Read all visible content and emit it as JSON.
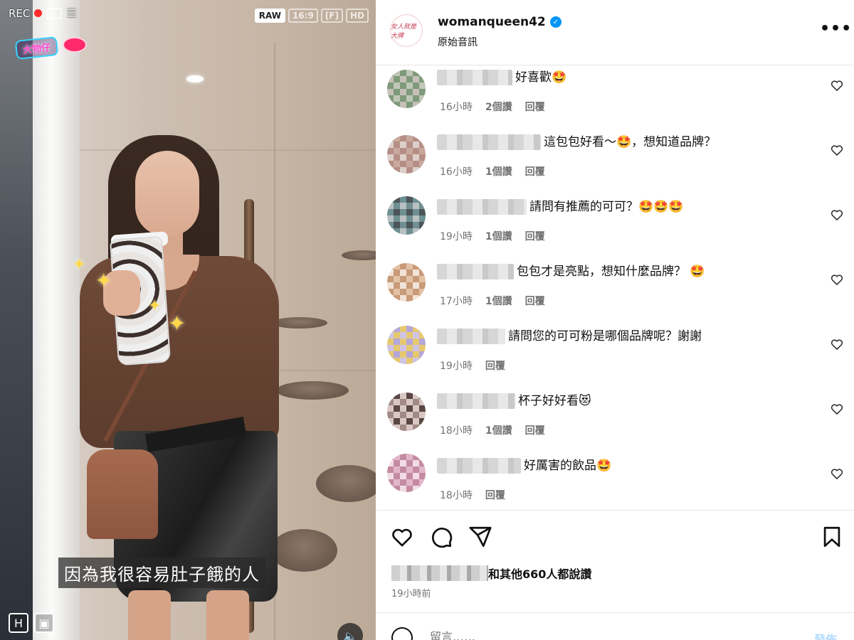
{
  "video": {
    "rec_label": "REC",
    "camera_tags": [
      "RAW",
      "16:9",
      "[F]",
      "HD"
    ],
    "sticker_text": "大物仔",
    "subtitle": "因為我很容易肚子餓的人",
    "bottom_icons": [
      "H",
      "▣"
    ]
  },
  "header": {
    "username": "womanqueen42",
    "verified": true,
    "audio_label": "原始音訊",
    "avatar_text": "女人就是大牌"
  },
  "comments": [
    {
      "text": "好喜歡🤩",
      "time": "16小時",
      "likes": "2個讚",
      "reply": "回覆",
      "avatar_colors": [
        "#bfc7b7",
        "#7f9a7a",
        "#c6c0b8"
      ]
    },
    {
      "text": "這包包好看～🤩，想知道品牌？",
      "time": "16小時",
      "likes": "1個讚",
      "reply": "回覆",
      "avatar_colors": [
        "#c9a99e",
        "#b58f86",
        "#ddd0cb"
      ]
    },
    {
      "text": "請問有推薦的可可？🤩🤩🤩",
      "time": "19小時",
      "likes": "1個讚",
      "reply": "回覆",
      "avatar_colors": [
        "#4d5558",
        "#6f8f92",
        "#b8c0c2"
      ]
    },
    {
      "text": "包包才是亮點，想知什麼品牌？ 🤩",
      "time": "17小時",
      "likes": "1個讚",
      "reply": "回覆",
      "avatar_colors": [
        "#e3c2a6",
        "#c89a78",
        "#f1e3d6"
      ]
    },
    {
      "text": "請問您的可可粉是哪個品牌呢？謝謝",
      "time": "19小時",
      "likes": "",
      "reply": "回覆",
      "avatar_colors": [
        "#b5a7d9",
        "#e6c86f",
        "#cfc4e6"
      ]
    },
    {
      "text": "杯子好好看😻",
      "time": "18小時",
      "likes": "1個讚",
      "reply": "回覆",
      "avatar_colors": [
        "#5a4644",
        "#d9c7c3",
        "#a18a86"
      ]
    },
    {
      "text": "好厲害的飲品🤩",
      "time": "18小時",
      "likes": "",
      "reply": "回覆",
      "avatar_colors": [
        "#e2b6c9",
        "#c48ba0",
        "#f1dce6"
      ]
    }
  ],
  "actions": {
    "likes_text": "和其他660人都說讚",
    "posted_time": "19小時前",
    "comment_placeholder": "留言……",
    "post_label": "發佈"
  },
  "colors": {
    "verified": "#0095f6",
    "meta_gray": "#737373",
    "post_button": "#b3dbff",
    "rec_dot": "#ff2a2a"
  }
}
